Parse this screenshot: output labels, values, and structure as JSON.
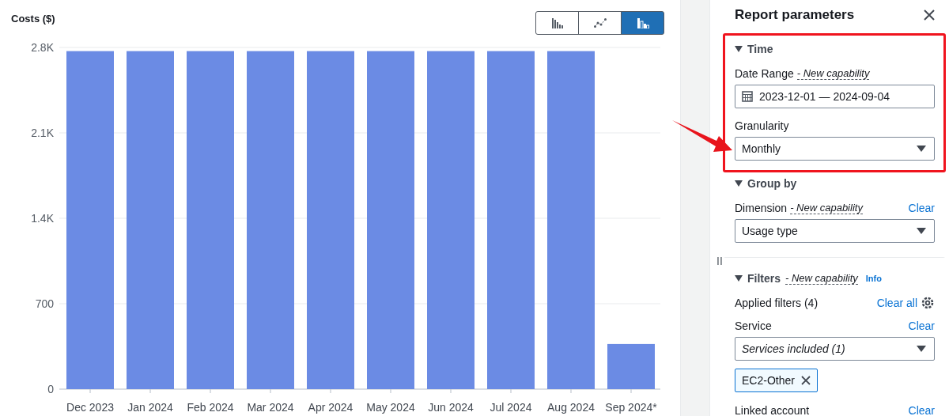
{
  "chart": {
    "chart_data": {
      "type": "bar",
      "ylabel": "Costs ($)",
      "categories": [
        "Dec 2023",
        "Jan 2024",
        "Feb 2024",
        "Mar 2024",
        "Apr 2024",
        "May 2024",
        "Jun 2024",
        "Jul 2024",
        "Aug 2024",
        "Sep 2024*"
      ],
      "grid": true,
      "series": [
        {
          "color": "#6b8be4",
          "values": [
            2770,
            2770,
            2770,
            2770,
            2770,
            2770,
            2770,
            2770,
            2770,
            370
          ]
        }
      ],
      "ylim": [
        0,
        2800
      ],
      "yticks": [
        {
          "value": 0,
          "label": "0"
        },
        {
          "value": 700,
          "label": "700"
        },
        {
          "value": 1400,
          "label": "1.4K"
        },
        {
          "value": 2100,
          "label": "2.1K"
        },
        {
          "value": 2800,
          "label": "2.8K"
        }
      ]
    },
    "view_buttons": [
      {
        "kind": "bar",
        "selected": false
      },
      {
        "kind": "line",
        "selected": false
      },
      {
        "kind": "stacked",
        "selected": true
      }
    ]
  },
  "panel": {
    "title": "Report parameters",
    "resize_handle": "II",
    "sections": [
      {
        "title": "Time",
        "expanded": true,
        "highlighted": true,
        "fields": [
          {
            "kind": "date",
            "label": "Date Range",
            "note": "- New capability",
            "value": "2023-12-01 — 2024-09-04"
          },
          {
            "kind": "select",
            "label": "Granularity",
            "value": "Monthly"
          }
        ]
      },
      {
        "title": "Group by",
        "expanded": true,
        "highlighted": false,
        "fields": [
          {
            "kind": "select",
            "label": "Dimension",
            "note": "- New capability",
            "action": "Clear",
            "value": "Usage type"
          }
        ]
      },
      {
        "title": "Filters",
        "note": "- New capability",
        "info": "Info",
        "expanded": true,
        "highlighted": false,
        "fields": [
          {
            "kind": "applied",
            "label": "Applied filters (4)",
            "action": "Clear all"
          },
          {
            "kind": "select",
            "label": "Service",
            "action": "Clear",
            "value": "Services included (1)",
            "italic": true,
            "tokens": [
              "EC2-Other"
            ]
          },
          {
            "kind": "label",
            "label": "Linked account",
            "action": "Clear"
          }
        ]
      }
    ]
  }
}
